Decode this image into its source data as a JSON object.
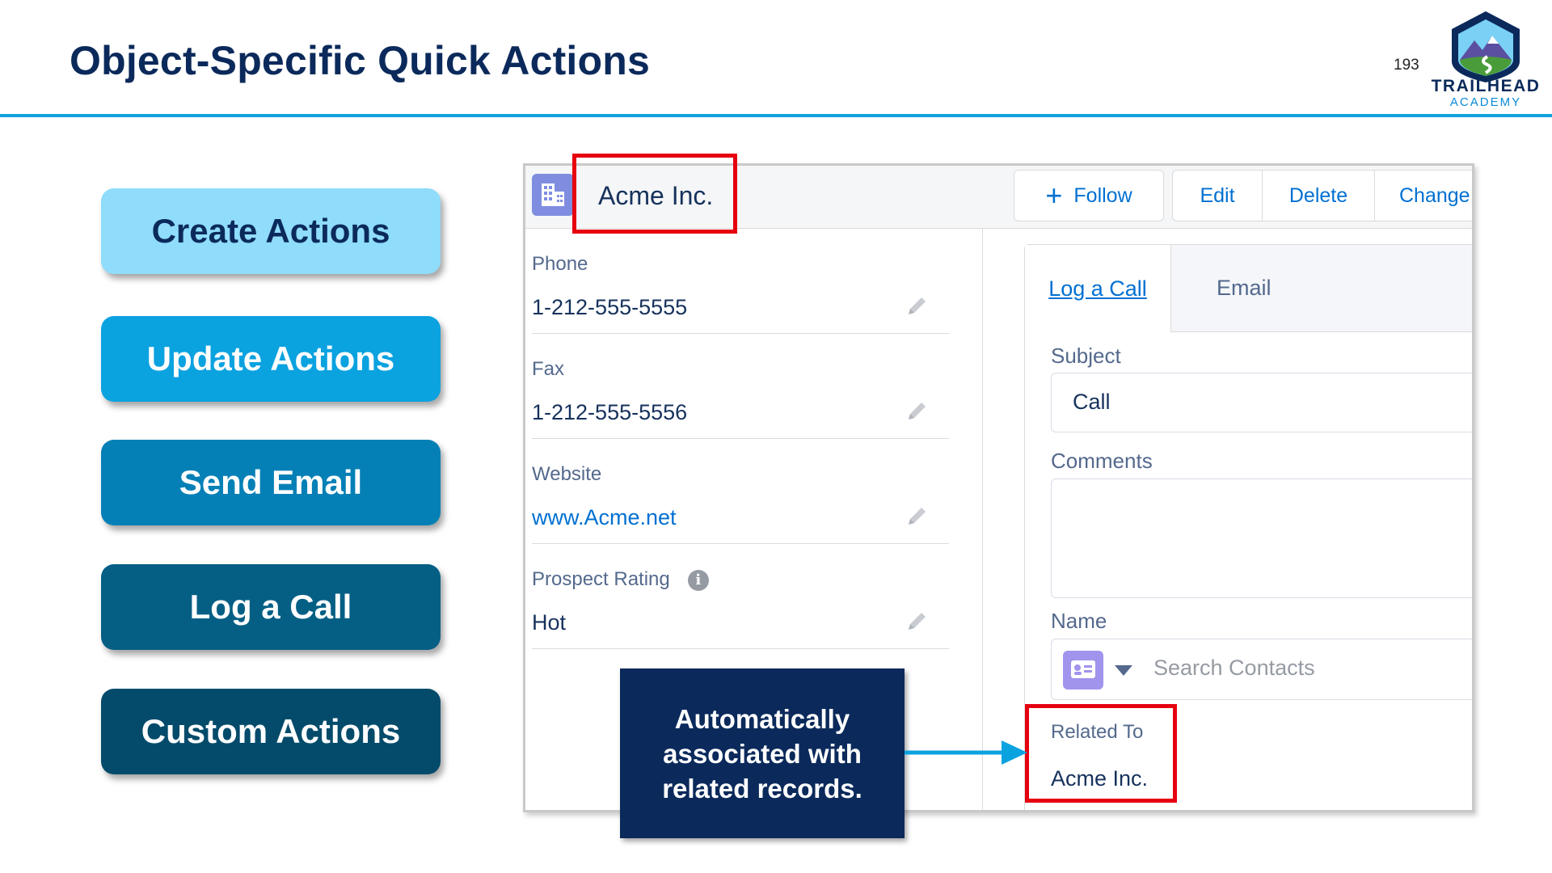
{
  "slide": {
    "title": "Object-Specific Quick Actions",
    "page_number": "193",
    "logo": {
      "line1": "TRAILHEAD",
      "line2": "ACADEMY",
      "icon": "trailhead-mountain-badge"
    }
  },
  "actions": [
    {
      "label": "Create Actions",
      "color": "#8fdcfb"
    },
    {
      "label": "Update Actions",
      "color": "#0ba2e0"
    },
    {
      "label": "Send Email",
      "color": "#0580b6"
    },
    {
      "label": "Log a Call",
      "color": "#055f85"
    },
    {
      "label": "Custom Actions",
      "color": "#044b6b"
    }
  ],
  "record": {
    "icon": "account-building-icon",
    "name": "Acme Inc.",
    "header_buttons": {
      "follow": "Follow",
      "edit": "Edit",
      "delete": "Delete",
      "change": "Change"
    },
    "fields": [
      {
        "label": "Phone",
        "value": "1-212-555-5555"
      },
      {
        "label": "Fax",
        "value": "1-212-555-5556"
      },
      {
        "label": "Website",
        "value": "www.Acme.net"
      },
      {
        "label": "Prospect Rating",
        "value": "Hot"
      }
    ]
  },
  "publisher": {
    "tabs": [
      "Log a Call",
      "Email"
    ],
    "active_tab": "Log a Call",
    "subject_label": "Subject",
    "subject_value": "Call",
    "comments_label": "Comments",
    "comments_value": "",
    "name_label": "Name",
    "name_placeholder": "Search Contacts",
    "related_label": "Related To",
    "related_value": "Acme Inc."
  },
  "callout": {
    "lines": [
      "Automatically",
      "associated with",
      "related records."
    ]
  },
  "colors": {
    "title": "#0b2a5b",
    "rule": "#0ea1dd",
    "highlight": "#e6000f",
    "callout_bg": "#0b2a5b",
    "link": "#0070d2"
  }
}
